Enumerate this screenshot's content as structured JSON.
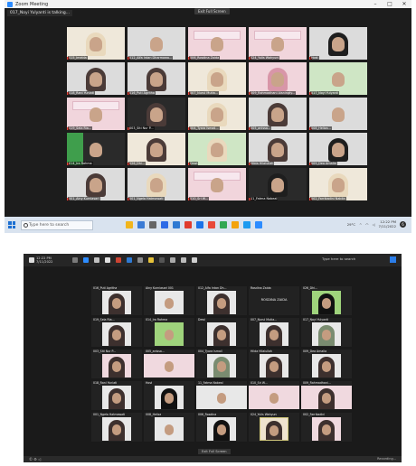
{
  "shot1": {
    "window_title": "Zoom Meeting",
    "talking_indicator": "017_Noyi Yulyanti is talking...",
    "view_button": "Exit Full Screen",
    "window_controls": [
      "–",
      "□",
      "✕"
    ],
    "participants": [
      {
        "name": "015_Imelda",
        "bg": "cream",
        "hijab": "cr"
      },
      {
        "name": "012_Alfa Intan Dharmawa...",
        "bg": "white",
        "hijab": ""
      },
      {
        "name": "006_Rosdina Zaida",
        "bg": "pink",
        "hijab": "",
        "slide": true
      },
      {
        "name": "024_Yulis Wahyuni",
        "bg": "pink",
        "hijab": "",
        "slide": true
      },
      {
        "name": "Host",
        "bg": "white",
        "hijab": "bk"
      },
      {
        "name": "018_Rani Yuniati",
        "bg": "white",
        "hijab": "dk"
      },
      {
        "name": "016_Puti Agritha",
        "bg": "white",
        "hijab": "dk"
      },
      {
        "name": "007_Nurul Mutia...",
        "bg": "cream",
        "hijab": "cr"
      },
      {
        "name": "009_Rahmadhani Aisningty...",
        "bg": "pink",
        "hijab": "pk"
      },
      {
        "name": "017_Noyi Yulyanti",
        "bg": "green",
        "hijab": ""
      },
      {
        "name": "019_Sela Ria...",
        "bg": "pink",
        "hijab": "",
        "slide": true
      },
      {
        "name": "003_Siti Nur P...",
        "bg": "dark",
        "hijab": "dk"
      },
      {
        "name": "004_Tyara Ismail...",
        "bg": "cream",
        "hijab": "cr"
      },
      {
        "name": "005_anissa...",
        "bg": "white",
        "hijab": "dk"
      },
      {
        "name": "008_Heliza...",
        "bg": "white",
        "hijab": ""
      },
      {
        "name": "014_Ira Rahma",
        "bg": "dark",
        "hijab": "",
        "green": true
      },
      {
        "name": "026_Dhi...",
        "bg": "cream",
        "hijab": "dk"
      },
      {
        "name": "Dewi",
        "bg": "green",
        "hijab": "cr"
      },
      {
        "name": "Hilda Hilalullah",
        "bg": "white",
        "hijab": "dk"
      },
      {
        "name": "009_Dea Amalia",
        "bg": "white",
        "hijab": "bk"
      },
      {
        "name": "001_Ainy Kurniasari",
        "bg": "white",
        "hijab": "dk"
      },
      {
        "name": "001_Ngela Hatmawati",
        "bg": "white",
        "hijab": "cr"
      },
      {
        "name": "010_Sri W...",
        "bg": "pink",
        "hijab": "",
        "slide": true
      },
      {
        "name": "11_Fatma Nabeal",
        "bg": "dark",
        "hijab": "bk"
      },
      {
        "name": "002_Farrikadini Nabila",
        "bg": "cream",
        "hijab": "cr"
      }
    ],
    "taskbar": {
      "search_placeholder": "Type here to search",
      "weather": "29°C",
      "time": "12:22 PM",
      "date": "7/11/2022",
      "notification_count": "6",
      "app_colors": [
        "#f1b51c",
        "#3a7bd5",
        "#666666",
        "#2e6be6",
        "#2f7ad2",
        "#e03b2d",
        "#1a73e8",
        "#e84a3a",
        "#32a853",
        "#f3a30c",
        "#1d9bf0",
        "#2d8cff"
      ]
    }
  },
  "shot2": {
    "clock_time": "12:22 PM",
    "clock_date": "7/11/2022",
    "search_label": "Type here to search",
    "view_button": "Exit Full Screen",
    "bottom_left": "© ⚙ ◁",
    "bottom_right": "Recording...",
    "toolbar_colors": [
      "#7a7a7a",
      "#2d8cff",
      "#c0c0c0",
      "#e0e0e0",
      "#cc4433",
      "#2f7ad2",
      "#8a8a8a",
      "#e6c23a",
      "#555555",
      "#aaaaaa",
      "#bbbbbb",
      "#cfcfcf"
    ],
    "participants": [
      {
        "name": "016_Puti Agritha",
        "pic": "",
        "hijab": "dk"
      },
      {
        "name": "Ainy Kurniasari 001",
        "pic": "",
        "hijab": ""
      },
      {
        "name": "012_Alfa Intan Dh...",
        "pic": "",
        "hijab": "dk"
      },
      {
        "name": "Rosdina Zaida",
        "pic": "none",
        "label": "ROSDINA ZAIDA"
      },
      {
        "name": "026_Dhi...",
        "pic": "green",
        "hijab": "bk"
      },
      {
        "name": "019_Sela Ria...",
        "pic": "",
        "hijab": "dk"
      },
      {
        "name": "014_Ira Rahma",
        "pic": "green",
        "hijab": ""
      },
      {
        "name": "Dewi",
        "pic": "",
        "hijab": "dk"
      },
      {
        "name": "007_Nurul Mutia...",
        "pic": "",
        "hijab": "dk"
      },
      {
        "name": "017_Noyi Yulyanti",
        "pic": "",
        "hijab": "gr"
      },
      {
        "name": "003_Siti Nur P...",
        "pic": "pink",
        "hijab": "dk"
      },
      {
        "name": "005_anissa...",
        "pic": "pink",
        "hijab": "",
        "wide": true
      },
      {
        "name": "004_Tyara Ismail",
        "pic": "",
        "hijab": "gr"
      },
      {
        "name": "Hilda Hilalullah",
        "pic": "",
        "hijab": "dk"
      },
      {
        "name": "009_Dea Amalia",
        "pic": "",
        "hijab": "dk"
      },
      {
        "name": "018_Rani Yuniati",
        "pic": "",
        "hijab": "dk"
      },
      {
        "name": "Host",
        "pic": "",
        "hijab": "bk"
      },
      {
        "name": "11_Fatma Nabeal",
        "pic": "",
        "hijab": "",
        "wide": true
      },
      {
        "name": "010_Sri W...",
        "pic": "pink",
        "hijab": "",
        "wide": true
      },
      {
        "name": "009_Rahmadhani...",
        "pic": "pink",
        "hijab": "dk",
        "wide": true
      },
      {
        "name": "001_Ngela Hatmawati",
        "pic": "",
        "hijab": "dk"
      },
      {
        "name": "008_Heliza",
        "pic": "",
        "hijab": ""
      },
      {
        "name": "006_Rosdina",
        "pic": "",
        "hijab": "bk"
      },
      {
        "name": "024_Yulis Wahyuni",
        "pic": "cream",
        "hijab": "dk",
        "flip": true
      },
      {
        "name": "002_Farrikadini",
        "pic": "pink",
        "hijab": "dk"
      }
    ]
  }
}
